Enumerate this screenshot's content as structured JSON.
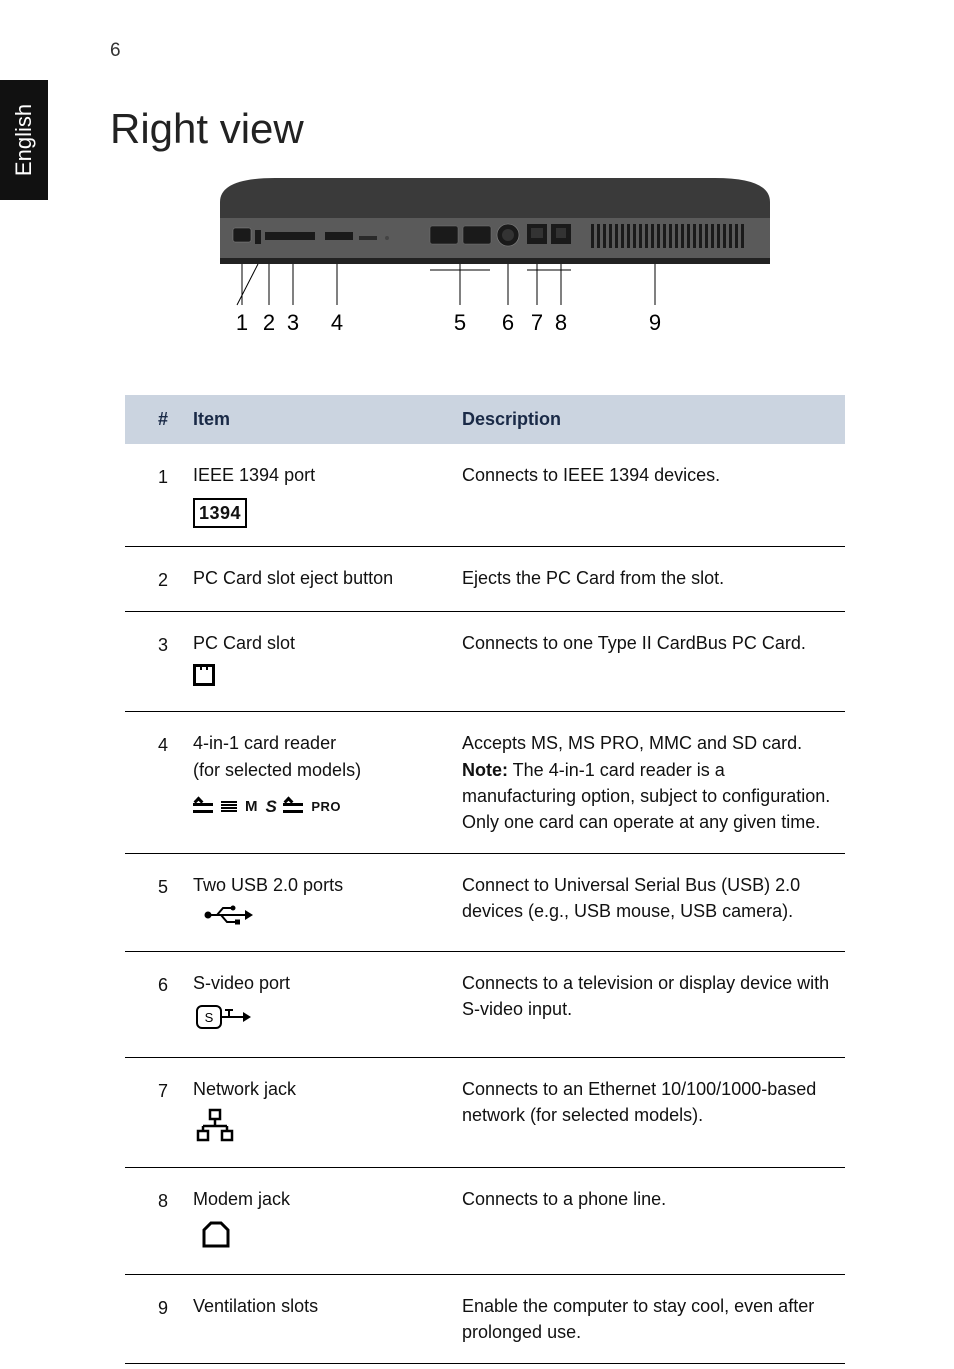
{
  "page_number": "6",
  "language_tab": "English",
  "heading": "Right view",
  "diagram_callouts": [
    "1",
    "2",
    "3",
    "4",
    "5",
    "6",
    "7",
    "8",
    "9"
  ],
  "table": {
    "headers": {
      "hash": "#",
      "item": "Item",
      "description": "Description"
    },
    "rows": [
      {
        "num": "1",
        "item": "IEEE 1394 port",
        "icon_label": "1394",
        "desc": "Connects to IEEE 1394 devices."
      },
      {
        "num": "2",
        "item": "PC Card slot eject button",
        "desc": "Ejects the PC Card from the slot."
      },
      {
        "num": "3",
        "item": "PC Card slot",
        "desc": "Connects to one Type II CardBus PC Card."
      },
      {
        "num": "4",
        "item_line1": "4-in-1 card reader",
        "item_line2": "(for selected models)",
        "logos": {
          "m": "M",
          "sd": "S",
          "pro": "PRO"
        },
        "desc_line1": "Accepts MS, MS PRO, MMC and SD card.",
        "desc_note_label": "Note:",
        "desc_note_rest": " The 4-in-1 card reader is a manufacturing option, subject to configuration. Only one card can operate at any given time."
      },
      {
        "num": "5",
        "item": "Two USB 2.0 ports",
        "desc": "Connect to Universal Serial Bus (USB) 2.0 devices (e.g., USB mouse, USB camera)."
      },
      {
        "num": "6",
        "item": "S-video port",
        "desc": "Connects to a television or display device with S-video input."
      },
      {
        "num": "7",
        "item": "Network jack",
        "desc": "Connects to an Ethernet 10/100/1000-based network (for selected models)."
      },
      {
        "num": "8",
        "item": "Modem jack",
        "desc": "Connects to a phone line."
      },
      {
        "num": "9",
        "item": "Ventilation slots",
        "desc": "Enable the computer to stay cool, even after prolonged use."
      }
    ]
  }
}
